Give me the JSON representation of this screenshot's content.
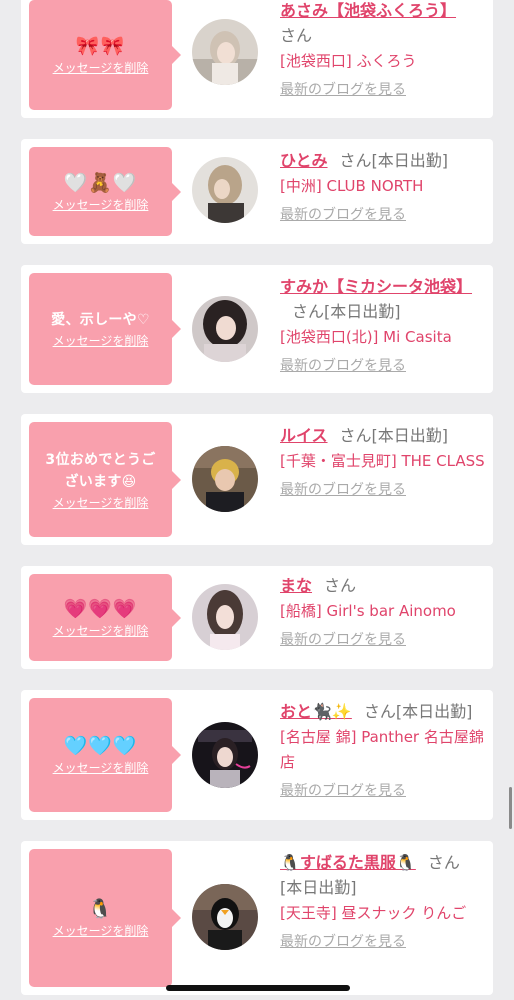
{
  "delete_label": "メッセージを削除",
  "san_label": "さん",
  "blog_label": "最新のブログを見る",
  "cards": [
    {
      "message": "🎀🎀",
      "name": "あさみ【池袋ふくろう】",
      "status": "",
      "shop": "[池袋西口] ふくろう"
    },
    {
      "message": "🤍🧸🤍",
      "name": "ひとみ",
      "status": "[本日出勤]",
      "shop": "[中洲] CLUB NORTH"
    },
    {
      "message": "愛、示しーや♡",
      "name": "すみか【ミカシータ池袋】",
      "status": "[本日出勤]",
      "shop": "[池袋西口(北)] Mi Casita"
    },
    {
      "message": "3位おめでとうございます😆",
      "name": "ルイス",
      "status": "[本日出勤]",
      "shop": "[千葉・富士見町] THE CLASS"
    },
    {
      "message": "💗💗💗",
      "name": "まな",
      "status": "",
      "shop": "[船橋] Girl's bar Ainomo"
    },
    {
      "message": "🩵🩵🩵",
      "name": "おと🐈‍⬛✨",
      "status": "[本日出勤]",
      "shop": "[名古屋 錦] Panther 名古屋錦店"
    },
    {
      "message": "🐧",
      "name": "🐧すばるた黒服🐧",
      "status": "[本日出勤]",
      "shop": "[天王寺] 昼スナック りんご"
    }
  ],
  "colors": {
    "accent": "#e0446b",
    "bubble": "#f9a0ad",
    "background": "#ececee",
    "muted": "#aaaaaa"
  }
}
